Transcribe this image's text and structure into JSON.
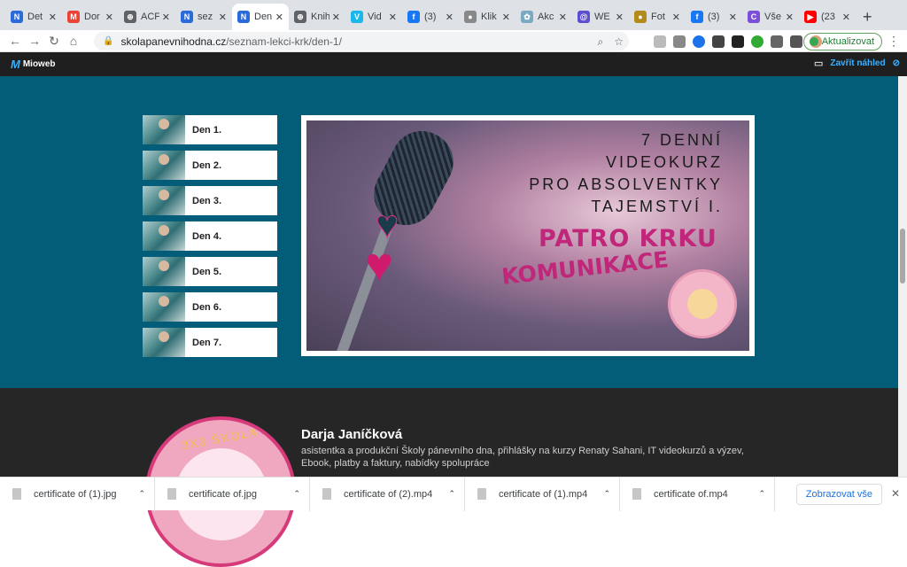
{
  "tabs": [
    {
      "title": "Det",
      "fav_color": "#2a6bd9",
      "fav_text": "N"
    },
    {
      "title": "Dor",
      "fav_color": "#ea4335",
      "fav_text": "M"
    },
    {
      "title": "ACF",
      "fav_color": "#5f6368",
      "fav_text": "⊕"
    },
    {
      "title": "sez",
      "fav_color": "#2a6bd9",
      "fav_text": "N"
    },
    {
      "title": "Den",
      "fav_color": "#2a6bd9",
      "fav_text": "N",
      "active": true
    },
    {
      "title": "Knih",
      "fav_color": "#5f6368",
      "fav_text": "⊕"
    },
    {
      "title": "Vid",
      "fav_color": "#1ab7ea",
      "fav_text": "V"
    },
    {
      "title": "(3)",
      "fav_color": "#1877f2",
      "fav_text": "f"
    },
    {
      "title": "Klik",
      "fav_color": "#888",
      "fav_text": "●"
    },
    {
      "title": "Akc",
      "fav_color": "#7aa9c2",
      "fav_text": "✿"
    },
    {
      "title": "WE",
      "fav_color": "#5a4fcf",
      "fav_text": "@"
    },
    {
      "title": "Fot",
      "fav_color": "#b38a1c",
      "fav_text": "●"
    },
    {
      "title": "(3)",
      "fav_color": "#1877f2",
      "fav_text": "f"
    },
    {
      "title": "Vše",
      "fav_color": "#7b4fd6",
      "fav_text": "C"
    },
    {
      "title": "(23",
      "fav_color": "#ff0000",
      "fav_text": "▶"
    }
  ],
  "address": {
    "domain": "skolapanevnihodna.cz",
    "path": "/seznam-lekci-krk/den-1/",
    "update_label": "Aktualizovat"
  },
  "mioweb": {
    "logo_text": "Mioweb",
    "close_preview": "Zavřít náhled"
  },
  "lessons": [
    {
      "label": "Den 1."
    },
    {
      "label": "Den 2."
    },
    {
      "label": "Den 3."
    },
    {
      "label": "Den 4."
    },
    {
      "label": "Den 5."
    },
    {
      "label": "Den 6."
    },
    {
      "label": "Den 7."
    }
  ],
  "banner": {
    "line1": "7 DENNÍ",
    "line2": "VIDEOKURZ",
    "line3": "PRO ABSOLVENTKY",
    "line4": "TAJEMSTVÍ I.",
    "title1": "PATRO KRKU",
    "title2": "KOMUNIKACE"
  },
  "footer": {
    "logo_text": "3X3  ŠKOLA  SAHANI",
    "name": "Darja Janíčková",
    "description": "asistentka a produkční Školy pánevního dna, přihlášky na kurzy Renaty Sahani, IT videokurzů a výzev, Ebook, platby a faktury, nabídky spolupráce"
  },
  "downloads": [
    {
      "name": "certificate of (1).jpg"
    },
    {
      "name": "certificate of.jpg"
    },
    {
      "name": "certificate of (2).mp4"
    },
    {
      "name": "certificate of (1).mp4"
    },
    {
      "name": "certificate of.mp4"
    }
  ],
  "downloads_show_all": "Zobrazovat vše"
}
